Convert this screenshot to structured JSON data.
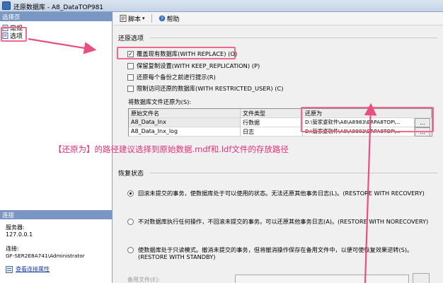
{
  "window": {
    "title": "还原数据库 - A8_DataTOP981"
  },
  "left_pane": {
    "select_page_header": "选择页",
    "pages": [
      {
        "label": "常规",
        "icon": "page-icon"
      },
      {
        "label": "选项",
        "icon": "page-icon"
      }
    ],
    "connection_header": "连接",
    "server_label": "服务器:",
    "server_value": "127.0.0.1",
    "connection_label": "连接:",
    "connection_value": "GF-SER2E8A741\\Administrator",
    "view_connection_properties": "查看连接属性"
  },
  "toolbar": {
    "script_label": "脚本",
    "help_label": "帮助"
  },
  "restore_options": {
    "title": "还原选项",
    "options": [
      {
        "label": "覆盖现有数据库(WITH REPLACE) (O)",
        "checked": true
      },
      {
        "label": "保留复制设置(WITH KEEP_REPLICATION) (P)",
        "checked": false
      },
      {
        "label": "还原每个备份之前进行提示(R)",
        "checked": false
      },
      {
        "label": "限制访问还原的数据库(WITH RESTRICTED_USER) (C)",
        "checked": false
      }
    ]
  },
  "restore_files": {
    "label": "将数据库文件还原为(S):",
    "columns": [
      "原始文件名",
      "文件类型",
      "还原为"
    ],
    "rows": [
      {
        "original": "A8_Data_Inx",
        "type": "行数据",
        "restore_as": "D:\\管家婆软件\\A8\\A8983\\ERPA8TOP\\...",
        "button": "..."
      },
      {
        "original": "A8_Data_Inx_log",
        "type": "日志",
        "restore_as": "D:\\管家婆软件\\A8\\A8983\\ERPA8TOP\\...",
        "button": "..."
      }
    ]
  },
  "annotation": "【还原为】的路径建议选择到原始数据.mdf和.ldf文件的存放路径",
  "recovery_state": {
    "title": "恢复状态",
    "options": [
      {
        "text": "回滚未提交的事务，使数据库处于可以使用的状态。无法还原其他事务日志(L)。(RESTORE WITH RECOVERY)",
        "selected": true
      },
      {
        "text": "不对数据库执行任何操作，不回滚未提交的事务。可以还原其他事务日志(A)。(RESTORE WITH NORECOVERY)",
        "selected": false
      },
      {
        "text_line1": "使数据库处于只读模式。撤消未提交的事务，但将撤消操作保存在备用文件中，以便可使恢复效果逆转(S)。",
        "text_line2": "(RESTORE WITH STANDBY)",
        "selected": false
      }
    ],
    "standby_file_label": "备用文件(E):"
  },
  "colors": {
    "annotation_pink": "#e0307a",
    "highlight_pink": "#f06a8a",
    "pane_header": "#7a96c2"
  }
}
